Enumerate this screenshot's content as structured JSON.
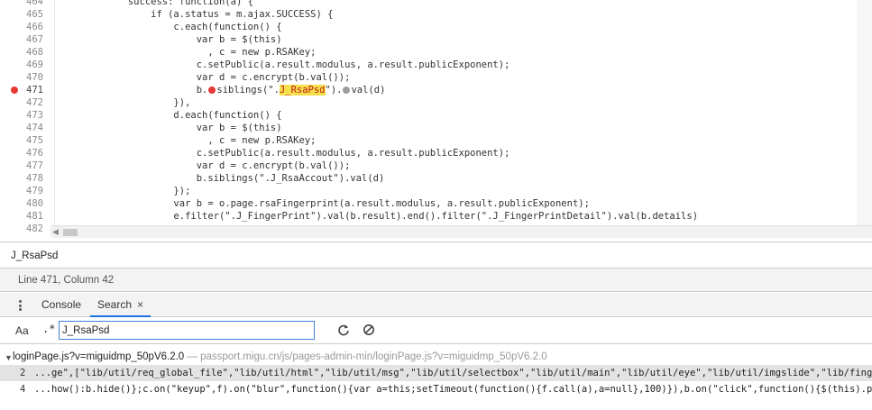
{
  "editor": {
    "lines": [
      {
        "num": "464",
        "text": "            success: function(a) {"
      },
      {
        "num": "465",
        "text": "                if (a.status = m.ajax.SUCCESS) {"
      },
      {
        "num": "466",
        "text": "                    c.each(function() {"
      },
      {
        "num": "467",
        "text": "                        var b = $(this)"
      },
      {
        "num": "468",
        "text": "                          , c = new p.RSAKey;"
      },
      {
        "num": "469",
        "text": "                        c.setPublic(a.result.modulus, a.result.publicExponent);"
      },
      {
        "num": "470",
        "text": "                        var d = c.encrypt(b.val());"
      },
      {
        "num": "471",
        "pre": "                        b.",
        "mid": "siblings(\".",
        "hl": "J_RsaPsd",
        "post1": "\").",
        "post2": "val(d)",
        "breakpoint": true
      },
      {
        "num": "472",
        "text": "                    }),"
      },
      {
        "num": "473",
        "text": "                    d.each(function() {"
      },
      {
        "num": "474",
        "text": "                        var b = $(this)"
      },
      {
        "num": "475",
        "text": "                          , c = new p.RSAKey;"
      },
      {
        "num": "476",
        "text": "                        c.setPublic(a.result.modulus, a.result.publicExponent);"
      },
      {
        "num": "477",
        "text": "                        var d = c.encrypt(b.val());"
      },
      {
        "num": "478",
        "text": "                        b.siblings(\".J_RsaAccout\").val(d)"
      },
      {
        "num": "479",
        "text": "                    });"
      },
      {
        "num": "480",
        "text": "                    var b = o.page.rsaFingerprint(a.result.modulus, a.result.publicExponent);"
      },
      {
        "num": "481",
        "text": "                    e.filter(\".J_FingerPrint\").val(b.result).end().filter(\".J_FingerPrintDetail\").val(b.details)"
      },
      {
        "num": "482",
        "text": ""
      }
    ]
  },
  "find_bar": {
    "value": "J_RsaPsd"
  },
  "status": {
    "text": "Line 471, Column 42"
  },
  "drawer": {
    "tabs": [
      {
        "label": "Console"
      },
      {
        "label": "Search",
        "close": "×"
      }
    ]
  },
  "search": {
    "case_toggle": "Aa",
    "regex_toggle": ".*",
    "query": "J_RsaPsd",
    "results": {
      "file_name": "loginPage.js?v=miguidmp_50pV6.2.0",
      "file_path": "passport.migu.cn/js/pages-admin-min/loginPage.js?v=miguidmp_50pV6.2.0",
      "separator": " — ",
      "lines": [
        {
          "num": "2",
          "text": "...ge\",[\"lib/util/req_global_file\",\"lib/util/html\",\"lib/util/msg\",\"lib/util/selectbox\",\"lib/util/main\",\"lib/util/eye\",\"lib/util/imgslide\",\"lib/fingerprint/fingerprint\",\"lib/rsa/rsa\",\"lib/artDialo"
        },
        {
          "num": "4",
          "text": "...how():b.hide()};c.on(\"keyup\",f).on(\"blur\",function(){var a=this;setTimeout(function(){f.call(a),a=null},100)}),b.on(\"click\",function(){$(this).parent().children(\"[placeholder-id=\"+$(thi"
        }
      ]
    }
  },
  "colors": {
    "breakpoint": "#e53935",
    "highlight": "#f4e04d",
    "tab_accent": "#1a73e8"
  }
}
